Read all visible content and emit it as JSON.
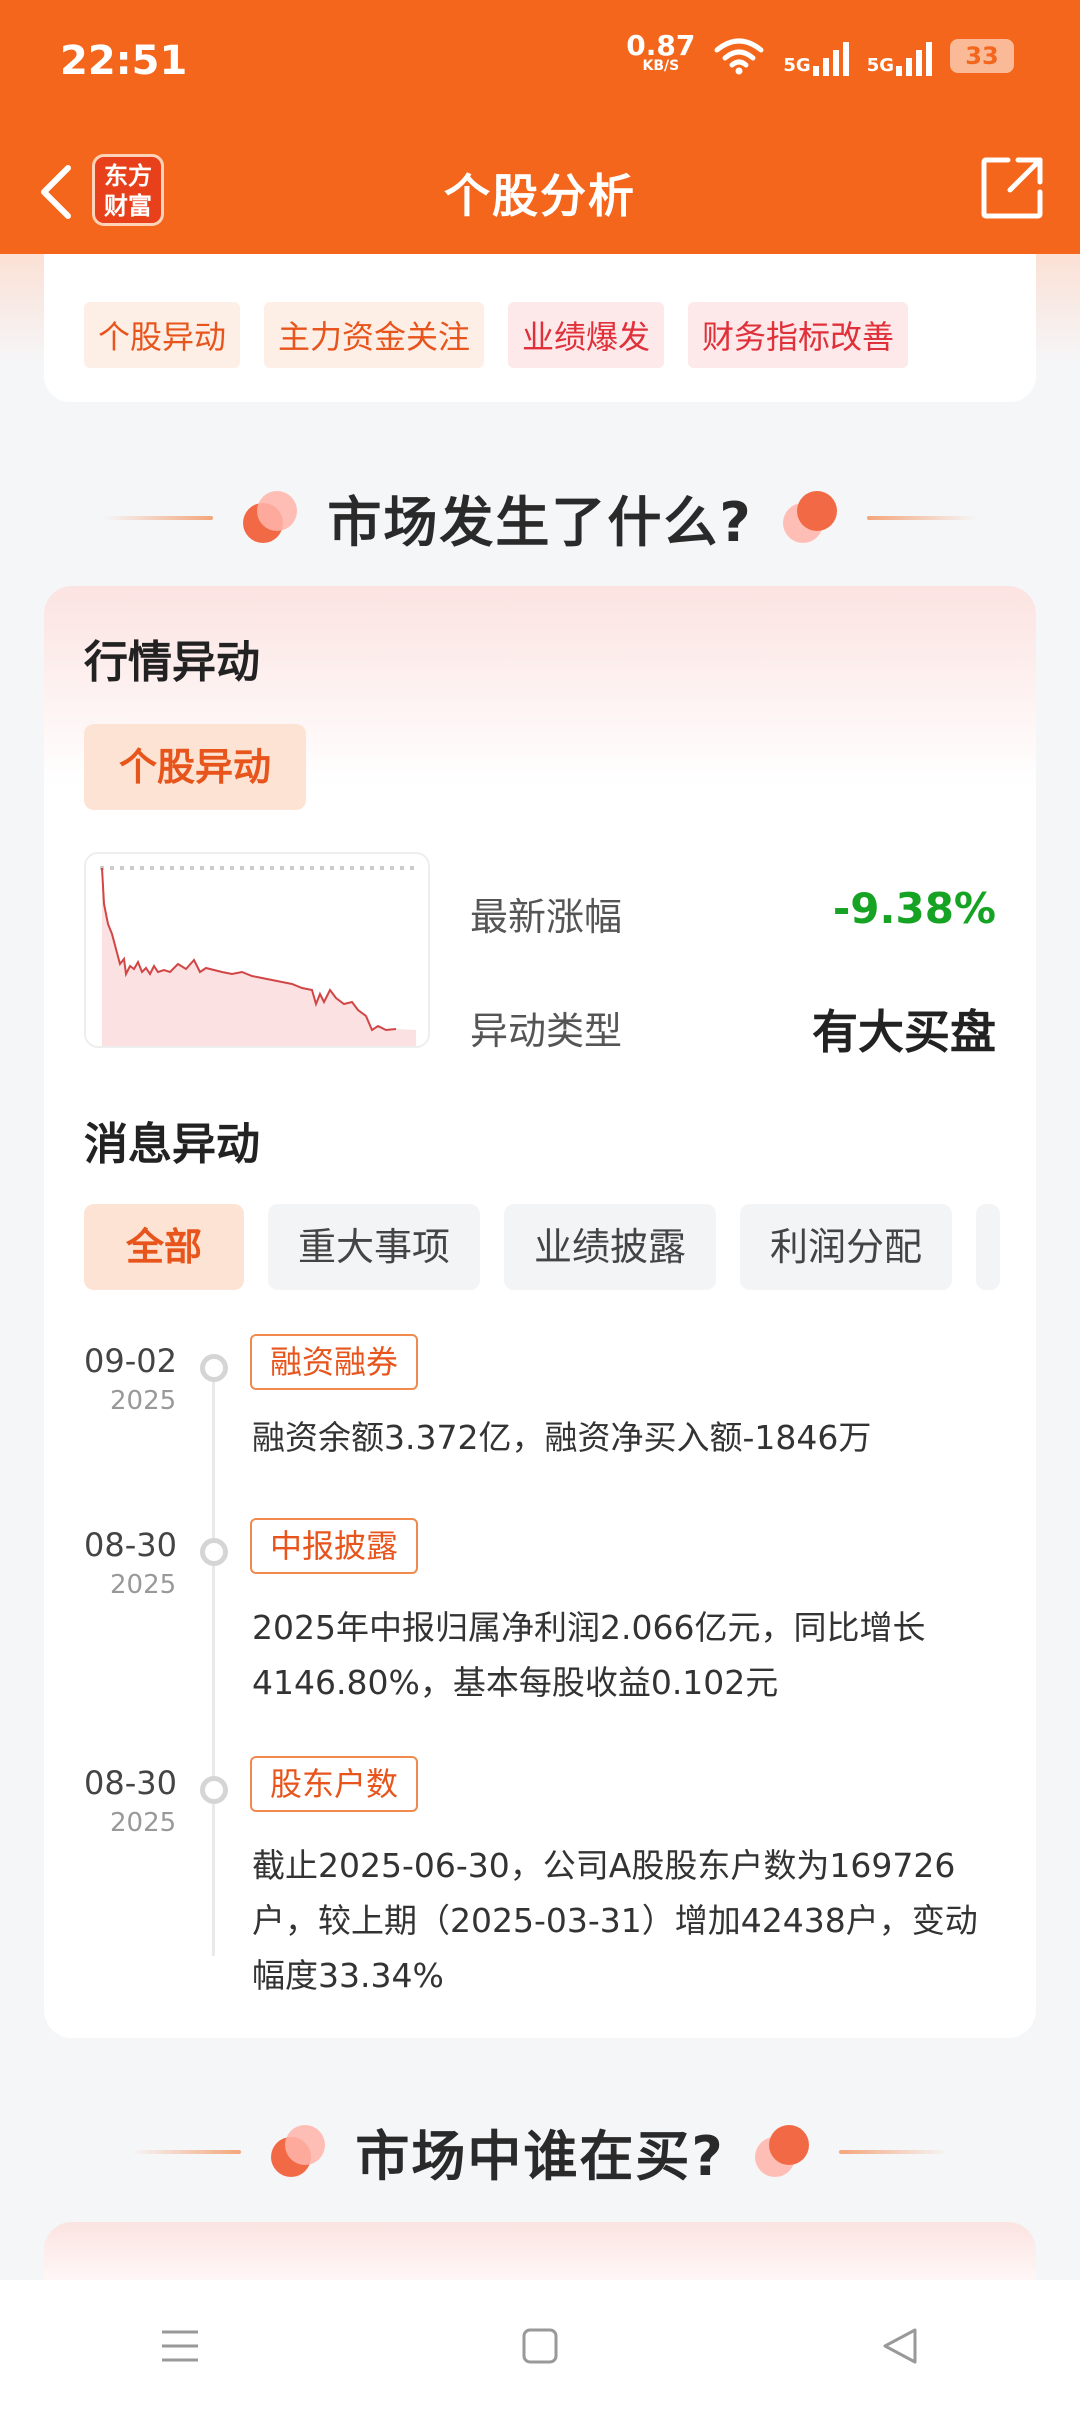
{
  "status_bar": {
    "time": "22:51",
    "net_speed_value": "0.87",
    "net_speed_unit": "KB/S",
    "signal_1": "5G",
    "signal_2": "5G",
    "battery": "33"
  },
  "nav": {
    "logo_line1": "东方",
    "logo_line2": "财富",
    "title": "个股分析"
  },
  "top_tags": [
    "个股异动",
    "主力资金关注",
    "业绩爆发",
    "财务指标改善"
  ],
  "section1": {
    "title": "市场发生了什么?"
  },
  "market_card": {
    "title": "行情异动",
    "badge": "个股异动",
    "latest_change_label": "最新涨幅",
    "latest_change_value": "-9.38%",
    "anomaly_type_label": "异动类型",
    "anomaly_type_value": "有大买盘",
    "news_title": "消息异动",
    "filters": [
      "全部",
      "重大事项",
      "业绩披露",
      "利润分配"
    ]
  },
  "timeline": [
    {
      "date": "09-02",
      "year": "2025",
      "tag": "融资融券",
      "text": "融资余额3.372亿，融资净买入额-1846万"
    },
    {
      "date": "08-30",
      "year": "2025",
      "tag": "中报披露",
      "text": "2025年中报归属净利润2.066亿元，同比增长4146.80%，基本每股收益0.102元"
    },
    {
      "date": "08-30",
      "year": "2025",
      "tag": "股东户数",
      "text": "截止2025-06-30，公司A股股东户数为169726户，较上期（2025-03-31）增加42438户，变动幅度33.34%"
    }
  ],
  "section2": {
    "title": "市场中谁在买?"
  },
  "colors": {
    "brand": "#f4661b",
    "down_green": "#16a324",
    "accent_red": "#e0303a"
  },
  "icons": [
    "back-arrow-icon",
    "share-icon",
    "menu-icon",
    "home-icon",
    "back-triangle-icon"
  ]
}
